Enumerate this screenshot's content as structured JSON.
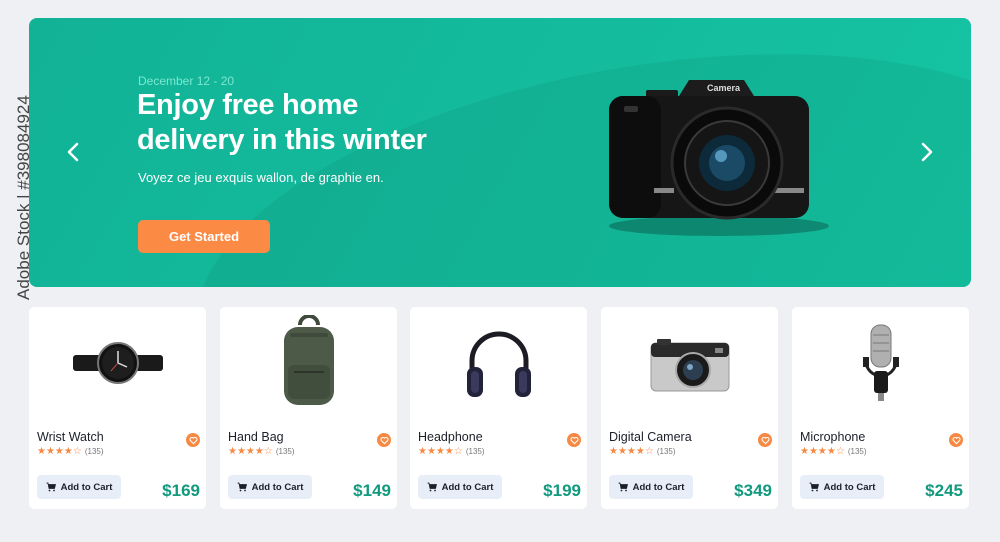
{
  "hero": {
    "date": "December 12 - 20",
    "title": "Enjoy free home delivery in this winter",
    "subtitle": "Voyez ce jeu exquis wallon, de graphie en.",
    "cta_label": "Get Started",
    "camera_text": "Camera"
  },
  "products": [
    {
      "name": "Wrist Watch",
      "rating_count": "(135)",
      "price": "$169",
      "cart_label": "Add to Cart",
      "image": "wrist-watch-image"
    },
    {
      "name": "Hand Bag",
      "rating_count": "(135)",
      "price": "$149",
      "cart_label": "Add to Cart",
      "image": "backpack-image"
    },
    {
      "name": "Headphone",
      "rating_count": "(135)",
      "price": "$199",
      "cart_label": "Add to Cart",
      "image": "headphone-image"
    },
    {
      "name": "Digital Camera",
      "rating_count": "(135)",
      "price": "$349",
      "cart_label": "Add to Cart",
      "image": "digital-camera-image"
    },
    {
      "name": "Microphone",
      "rating_count": "(135)",
      "price": "$245",
      "cart_label": "Add to Cart",
      "image": "microphone-image"
    }
  ],
  "stars": "★★★★☆",
  "watermark": "Adobe Stock | #398084924",
  "colors": {
    "accent": "#15c4a3",
    "cta": "#fb8a45",
    "price": "#12997e"
  }
}
